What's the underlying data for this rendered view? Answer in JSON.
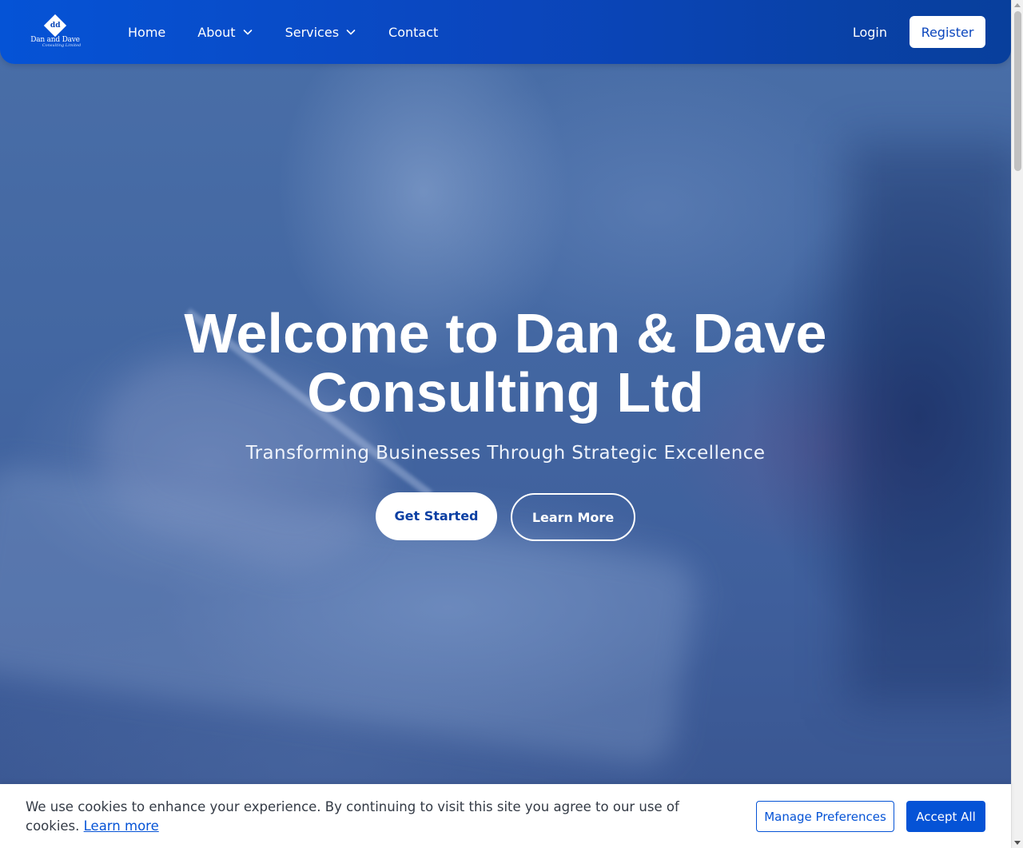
{
  "brand": {
    "name": "Dan and Dave",
    "tagline": "Consulting Limited",
    "monogram": "dd"
  },
  "nav": {
    "items": [
      {
        "label": "Home",
        "icon": null
      },
      {
        "label": "About",
        "icon": "chevron-down-icon"
      },
      {
        "label": "Services",
        "icon": "chevron-down-icon"
      },
      {
        "label": "Contact",
        "icon": null
      }
    ],
    "login_label": "Login",
    "register_label": "Register"
  },
  "hero": {
    "title": "Welcome to Dan & Dave Consulting Ltd",
    "subtitle": "Transforming Businesses Through Strategic Excellence",
    "primary_cta": "Get Started",
    "secondary_cta": "Learn More"
  },
  "cookie": {
    "message": "We use cookies to enhance your experience. By continuing to visit this site you agree to our use of cookies. ",
    "learn_more_label": "Learn more",
    "manage_label": "Manage Preferences",
    "accept_label": "Accept All"
  },
  "colors": {
    "brand_blue": "#0553d6",
    "nav_gradient_end": "#083f9c",
    "hero_overlay": "#3d5f98",
    "white": "#ffffff"
  }
}
